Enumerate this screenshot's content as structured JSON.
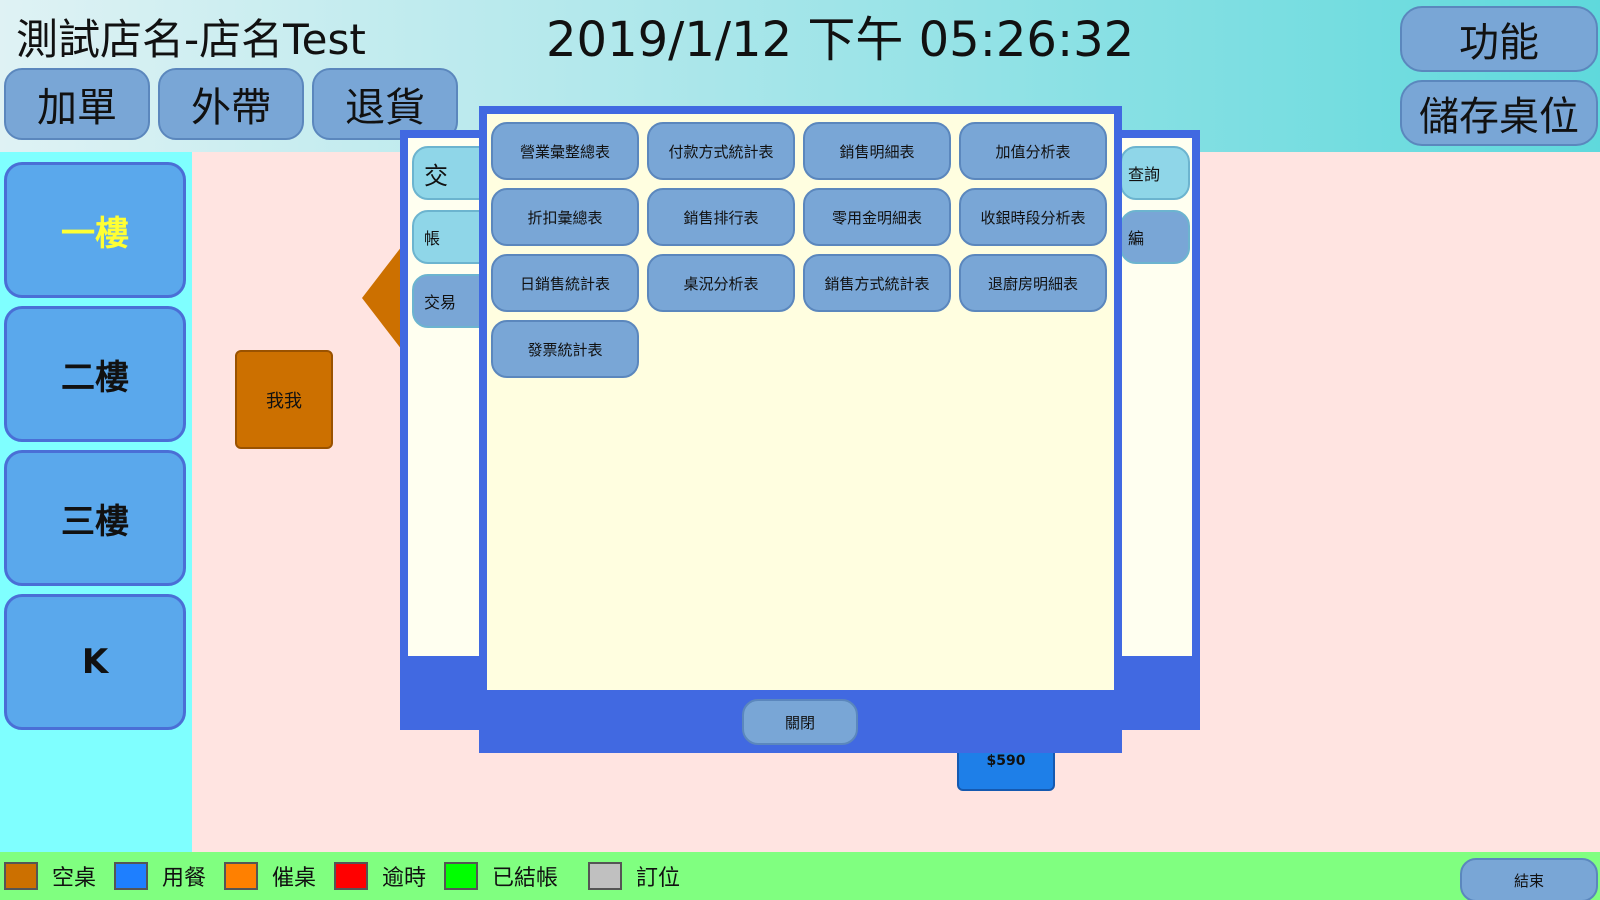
{
  "header": {
    "store_name": "測試店名-店名Test",
    "datetime": "2019/1/12 下午 05:26:32",
    "order_buttons": [
      "加單",
      "外帶",
      "退貨"
    ],
    "function_button": "功能",
    "save_table_button": "儲存桌位"
  },
  "floors": [
    "一樓",
    "二樓",
    "三樓",
    "K"
  ],
  "active_floor": "一樓",
  "floor_area": {
    "table_label": "我我",
    "amount": "$590"
  },
  "back_dialog": {
    "visible_fragments": [
      "交",
      "帳",
      "交易",
      "查詢",
      "編"
    ]
  },
  "report_dialog": {
    "buttons": [
      "營業彙整總表",
      "付款方式統計表",
      "銷售明細表",
      "加值分析表",
      "折扣彙總表",
      "銷售排行表",
      "零用金明細表",
      "收銀時段分析表",
      "日銷售統計表",
      "桌況分析表",
      "銷售方式統計表",
      "退廚房明細表",
      "發票統計表"
    ],
    "close": "關閉"
  },
  "legend": {
    "items": [
      {
        "label": "空桌",
        "color": "#cc7000"
      },
      {
        "label": "用餐",
        "color": "#1e7fff"
      },
      {
        "label": "催桌",
        "color": "#ff8000"
      },
      {
        "label": "逾時",
        "color": "#ff0000"
      },
      {
        "label": "已結帳",
        "color": "#00ff00"
      },
      {
        "label": "訂位",
        "color": "#c0c0c0"
      }
    ],
    "end_button": "結束"
  }
}
